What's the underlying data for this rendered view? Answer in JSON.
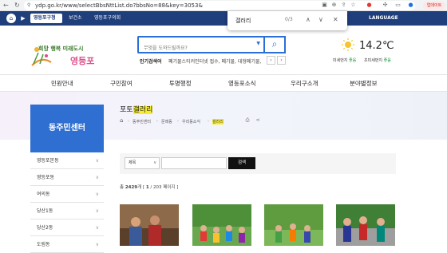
{
  "browser": {
    "url": "ydp.go.kr/www/selectBbsNttList.do?bbsNo=88&key=3053&",
    "update_label": "업데이트"
  },
  "find_bar": {
    "query": "갤러리",
    "count": "0/3"
  },
  "topbar": {
    "tabs": [
      "영등포구청",
      "보건소",
      "영등포구의회"
    ],
    "language": "LANGUAGE"
  },
  "logo": {
    "slogan": "희망 행복 미래도시",
    "name": "영등포"
  },
  "search": {
    "placeholder": "무엇을 도와드릴까요?",
    "popular_label": "인기검색어",
    "popular_text": "폐기물스티커인터넷 접수, 폐기물, 대형폐기물, 1"
  },
  "weather": {
    "temperature": "14.2℃",
    "fine_dust_label": "미세먼지",
    "fine_dust_value": "좋음",
    "ultra_dust_label": "초미세먼지",
    "ultra_dust_value": "좋음"
  },
  "gnb": [
    "민원안내",
    "구민참여",
    "투명행정",
    "영등포소식",
    "우리구소개",
    "분야별정보"
  ],
  "lnb": {
    "title": "동주민센터",
    "items": [
      "영등포본동",
      "영등포동",
      "여의동",
      "당산1동",
      "당산2동",
      "도림동"
    ]
  },
  "content": {
    "title_prefix": "포토",
    "title_highlight": "갤러리",
    "breadcrumb": [
      "동주민센터",
      "문래동",
      "우리동소식",
      "포토",
      "갤러리"
    ],
    "search_select": "제목",
    "search_button": "검색",
    "total_prefix": "총",
    "total_count": "2429",
    "total_unit": "개",
    "page_current": "1",
    "page_total": "/ 203 페이지"
  },
  "colors": {
    "topbar_bg": "#1f3e7c",
    "accent_blue": "#2f6fd1",
    "highlight": "#f6ec2f"
  }
}
